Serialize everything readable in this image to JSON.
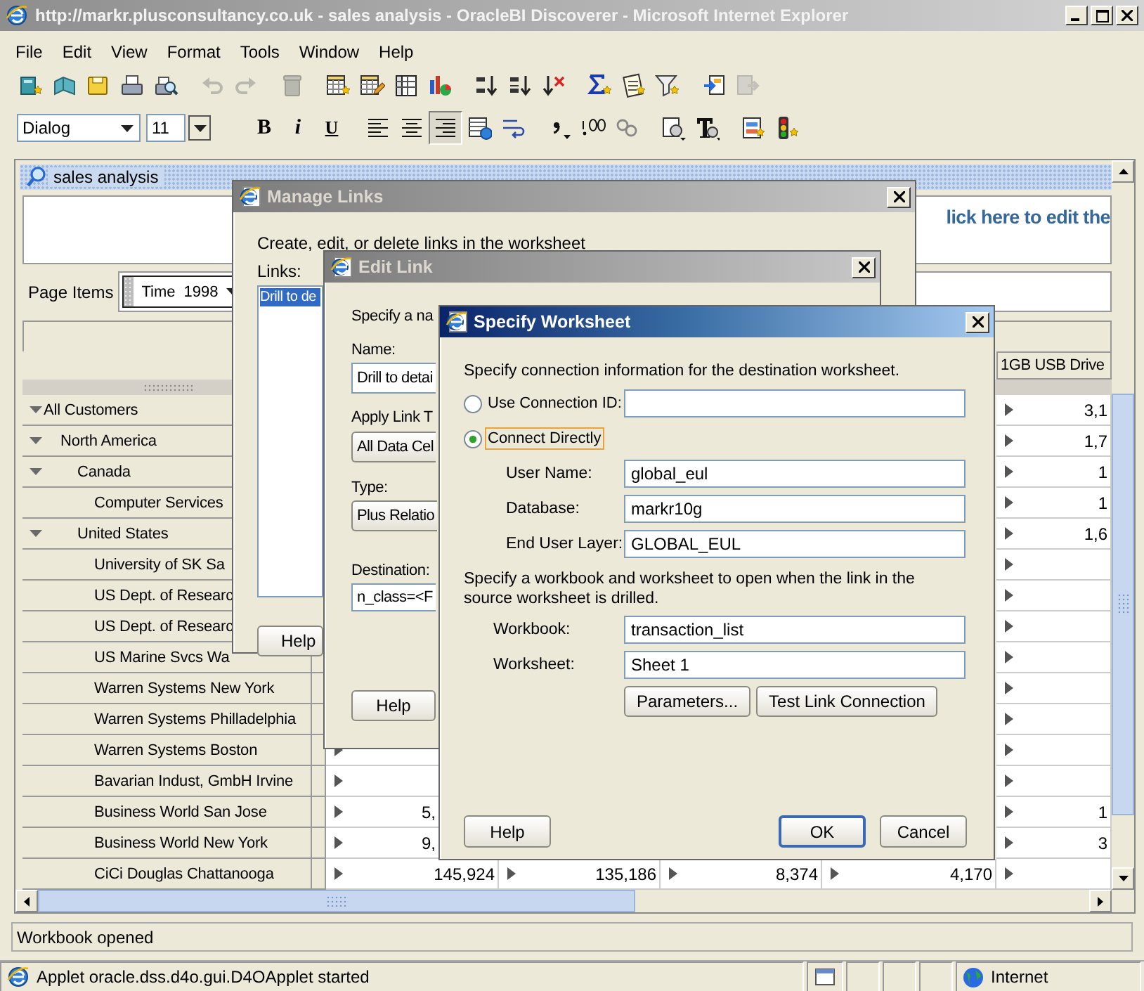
{
  "window": {
    "title": "http://markr.plusconsultancy.co.uk - sales analysis - OracleBI Discoverer - Microsoft Internet Explorer"
  },
  "menu": [
    "File",
    "Edit",
    "View",
    "Format",
    "Tools",
    "Window",
    "Help"
  ],
  "toolbar": [
    [
      {
        "kind": "newbook",
        "disabled": false
      },
      {
        "kind": "openbook",
        "disabled": false
      },
      {
        "kind": "save",
        "disabled": false
      },
      {
        "kind": "print",
        "disabled": false
      },
      {
        "kind": "preview",
        "disabled": false
      }
    ],
    [
      {
        "kind": "undo",
        "disabled": true
      },
      {
        "kind": "redo",
        "disabled": true
      }
    ],
    [
      {
        "kind": "delete",
        "disabled": true
      }
    ],
    [
      {
        "kind": "newsheet",
        "disabled": false
      },
      {
        "kind": "editsheet",
        "disabled": false
      },
      {
        "kind": "table",
        "disabled": false
      },
      {
        "kind": "chart",
        "disabled": false
      }
    ],
    [
      {
        "kind": "sortup",
        "disabled": false
      },
      {
        "kind": "sortdown",
        "disabled": false
      },
      {
        "kind": "clearsort",
        "disabled": false
      }
    ],
    [
      {
        "kind": "sum",
        "disabled": false
      },
      {
        "kind": "percent",
        "disabled": false
      },
      {
        "kind": "filter",
        "disabled": false
      }
    ],
    [
      {
        "kind": "export",
        "disabled": false
      },
      {
        "kind": "import",
        "disabled": true
      }
    ]
  ],
  "format_bar": {
    "font": "Dialog",
    "size": "11",
    "groups": [
      [
        {
          "kind": "bold",
          "label": "B"
        },
        {
          "kind": "italic",
          "label": "i"
        },
        {
          "kind": "underline",
          "label": "U"
        }
      ],
      [
        {
          "kind": "alignleft",
          "selected": false
        },
        {
          "kind": "aligncenter",
          "selected": false
        },
        {
          "kind": "alignright",
          "selected": true
        },
        {
          "kind": "tableformat"
        },
        {
          "kind": "wrap"
        }
      ],
      [
        {
          "kind": "comma"
        },
        {
          "kind": "decimal"
        },
        {
          "kind": "decimalless"
        }
      ],
      [
        {
          "kind": "condformat"
        },
        {
          "kind": "textformat"
        }
      ],
      [
        {
          "kind": "swap"
        },
        {
          "kind": "stoplight"
        }
      ]
    ]
  },
  "worksheet": {
    "tab": "sales analysis",
    "title": "lick here to edit the",
    "page_items_label": "Page Items",
    "page_items": [
      {
        "name": "Time",
        "value": "1998"
      }
    ],
    "table": {
      "header": {
        "column_5": "1GB USB Drive"
      },
      "rows": [
        {
          "label": "All Customers",
          "expanded": true,
          "column_5": {
            "drillable": true,
            "value": "3,1"
          },
          "children": [
            {
              "label": "North America",
              "expanded": true,
              "column_5": {
                "drillable": true,
                "value": "1,7"
              },
              "children": [
                {
                  "label": "Canada",
                  "expanded": true,
                  "column_5": {
                    "drillable": true,
                    "value": "1"
                  },
                  "children": [
                    {
                      "label": "Computer Services",
                      "column_5": {
                        "drillable": true,
                        "value": "1"
                      }
                    }
                  ]
                },
                {
                  "label": "United States",
                  "expanded": true,
                  "column_5": {
                    "drillable": true,
                    "value": "1,6"
                  },
                  "children": [
                    {
                      "label": "University of SK Sa",
                      "column_5": {
                        "drillable": true
                      }
                    },
                    {
                      "label": "US Dept. of Researc",
                      "column_5": {
                        "drillable": true
                      }
                    },
                    {
                      "label": "US Dept. of Researc",
                      "column_5": {
                        "drillable": true
                      }
                    },
                    {
                      "label": "US Marine Svcs Wa",
                      "column_5": {
                        "drillable": true
                      }
                    },
                    {
                      "label": "Warren Systems New York",
                      "column_5": {
                        "drillable": true
                      }
                    },
                    {
                      "label": "Warren Systems Philladelphia",
                      "column_5": {
                        "drillable": true
                      }
                    },
                    {
                      "label": "Warren Systems Boston",
                      "column_1": {
                        "drillable": true
                      },
                      "column_5": {
                        "drillable": true
                      }
                    },
                    {
                      "label": "Bavarian Indust, GmbH Irvine",
                      "column_1": {
                        "drillable": true
                      },
                      "column_5": {
                        "drillable": true
                      }
                    },
                    {
                      "label": "Business World San Jose",
                      "column_1": {
                        "drillable": true,
                        "value": "5,",
                        "cut": true
                      },
                      "column_5": {
                        "drillable": true,
                        "value": "1"
                      }
                    },
                    {
                      "label": "Business World New York",
                      "column_1": {
                        "drillable": true,
                        "value": "9,",
                        "cut": true
                      },
                      "column_5": {
                        "drillable": true,
                        "value": "3"
                      }
                    },
                    {
                      "label": "CiCi Douglas Chattanooga",
                      "column_1": {
                        "drillable": true,
                        "value": "145,924"
                      },
                      "column_2": {
                        "drillable": true,
                        "value": "135,186"
                      },
                      "column_3": {
                        "drillable": true,
                        "value": "8,374"
                      },
                      "column_4": {
                        "drillable": true,
                        "value": "4,170"
                      },
                      "column_5": {
                        "drillable": true
                      }
                    }
                  ]
                }
              ]
            }
          ]
        }
      ]
    }
  },
  "status": "Workbook opened",
  "browser_status": {
    "message": "Applet oracle.dss.d4o.gui.D4OApplet started",
    "zone": "Internet"
  },
  "manage_links": {
    "title": "Manage Links",
    "instructions": "Create, edit, or delete links in the worksheet",
    "links_label": "Links:",
    "links": [
      {
        "label": "Drill to de",
        "selected": true
      }
    ],
    "help": "Help"
  },
  "edit_link": {
    "title": "Edit Link",
    "instructions": "Specify a na",
    "name_label": "Name:",
    "name_value": "Drill to detai",
    "apply_label": "Apply Link T",
    "apply_value": "All Data Cel",
    "type_label": "Type:",
    "type_value": "Plus Relatio",
    "destination_label": "Destination:",
    "destination_value": "n_class=<F",
    "help": "Help"
  },
  "specify_worksheet": {
    "title": "Specify Worksheet",
    "intro": "Specify connection information for the destination worksheet.",
    "options": [
      {
        "label": "Use Connection ID:",
        "selected": false,
        "focused": false
      },
      {
        "label": "Connect Directly",
        "selected": true,
        "focused": true
      }
    ],
    "connection_fields": [
      {
        "label": "User Name:",
        "value": "global_eul"
      },
      {
        "label": "Database:",
        "value": "markr10g"
      },
      {
        "label": "End User Layer:",
        "value": "GLOBAL_EUL"
      }
    ],
    "workbook_intro": "Specify a workbook and worksheet to open when the link in the source worksheet is drilled.",
    "workbook_fields": [
      {
        "label": "Workbook:",
        "value": "transaction_list"
      },
      {
        "label": "Worksheet:",
        "value": "Sheet 1"
      }
    ],
    "actions": [
      "Parameters...",
      "Test Link Connection"
    ],
    "buttons": [
      {
        "label": "Help",
        "default": false
      },
      {
        "label": "OK",
        "default": true
      },
      {
        "label": "Cancel",
        "default": false
      }
    ]
  }
}
